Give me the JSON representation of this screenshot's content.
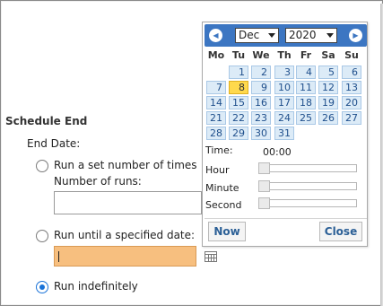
{
  "schedule_end": {
    "title": "Schedule End",
    "end_date_label": "End Date:",
    "option_run_times": "Run a set number of times",
    "number_of_runs_label": "Number of runs:",
    "number_of_runs_value": "",
    "option_until_date": "Run until a specified date:",
    "until_date_value": "",
    "option_indefinitely": "Run indefinitely",
    "selected_option": "indefinitely"
  },
  "calendar": {
    "prev_icon": "chevron-left-icon",
    "next_icon": "chevron-right-icon",
    "month": "Dec",
    "year": "2020",
    "weekdays": [
      "Mo",
      "Tu",
      "We",
      "Th",
      "Fr",
      "Sa",
      "Su"
    ],
    "weeks": [
      [
        "",
        "1",
        "2",
        "3",
        "4",
        "5",
        "6"
      ],
      [
        "7",
        "8",
        "9",
        "10",
        "11",
        "12",
        "13"
      ],
      [
        "14",
        "15",
        "16",
        "17",
        "18",
        "19",
        "20"
      ],
      [
        "21",
        "22",
        "23",
        "24",
        "25",
        "26",
        "27"
      ],
      [
        "28",
        "29",
        "30",
        "31",
        "",
        "",
        ""
      ]
    ],
    "today": "8",
    "time_label": "Time:",
    "time_value": "00:00",
    "hour_label": "Hour",
    "minute_label": "Minute",
    "second_label": "Second",
    "hour_value": 0,
    "minute_value": 0,
    "second_value": 0,
    "now_button": "Now",
    "close_button": "Close"
  },
  "colors": {
    "header_blue": "#3c76c2",
    "today_yellow": "#ffd94d",
    "date_input_orange": "#f7bf7f",
    "radio_blue": "#1a73d8"
  }
}
